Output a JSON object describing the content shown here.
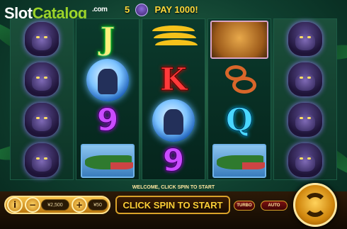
{
  "logo": {
    "slot": "Slot",
    "catalog": "Catalog",
    "com": ".com"
  },
  "header": {
    "paylines": "5",
    "pay_text": "PAY 1000!"
  },
  "reels": {
    "symbols": [
      [
        "gorilla",
        "gorilla",
        "gorilla",
        "gorilla"
      ],
      [
        "J",
        "gorilla-moon",
        "9",
        "crocodile"
      ],
      [
        "bananas",
        "K",
        "gorilla-moon",
        "9"
      ],
      [
        "leopard",
        "snake",
        "Q",
        "crocodile"
      ],
      [
        "gorilla",
        "gorilla",
        "gorilla",
        "gorilla"
      ]
    ],
    "letters": {
      "J": "J",
      "K": "K",
      "nine": "9",
      "Q": "Q"
    }
  },
  "status": {
    "message": "WELCOME, CLICK SPIN TO START"
  },
  "controls": {
    "info_icon": "i",
    "minus_icon": "−",
    "plus_icon": "+",
    "total_bet": "¥2,500",
    "line_bet": "¥50",
    "spin_label": "CLICK SPIN TO START",
    "turbo_label": "TURBO",
    "auto_label": "AUTO"
  },
  "icons": [
    "info-icon",
    "minus-icon",
    "plus-icon",
    "spin-arrows-icon",
    "gorilla-icon"
  ],
  "colors": {
    "accent": "#ffd036",
    "catalog_green": "#9cd42a",
    "background": "#0f3f2f"
  }
}
